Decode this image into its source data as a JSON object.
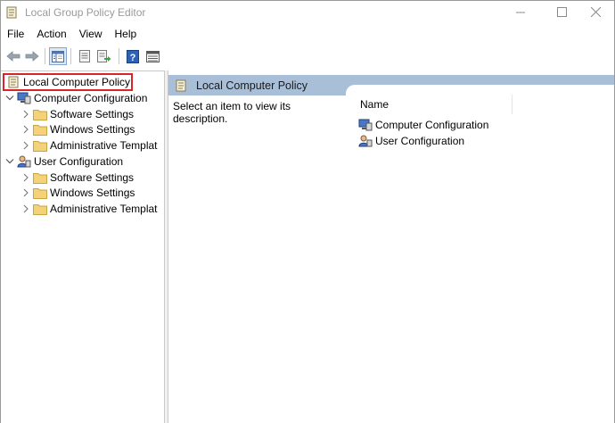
{
  "window": {
    "title": "Local Group Policy Editor"
  },
  "menu": [
    "File",
    "Action",
    "View",
    "Help"
  ],
  "toolbar": {
    "buttons": [
      "back-arrow-icon",
      "forward-arrow-icon",
      "show-hide-tree-icon",
      "properties-icon",
      "export-list-icon",
      "help-icon",
      "extended-view-icon"
    ]
  },
  "tree": {
    "root": "Local Computer Policy",
    "computer_config": {
      "label": "Computer Configuration",
      "children": [
        "Software Settings",
        "Windows Settings",
        "Administrative Templat"
      ]
    },
    "user_config": {
      "label": "User Configuration",
      "children": [
        "Software Settings",
        "Windows Settings",
        "Administrative Templat"
      ]
    }
  },
  "right": {
    "header": "Local Computer Policy",
    "description": "Select an item to view its description.",
    "column_name": "Name",
    "items": [
      "Computer Configuration",
      "User Configuration"
    ]
  },
  "colors": {
    "header_bar": "#a9bfd8",
    "highlight_border": "#d9252a",
    "folder": "#f3d27a"
  }
}
